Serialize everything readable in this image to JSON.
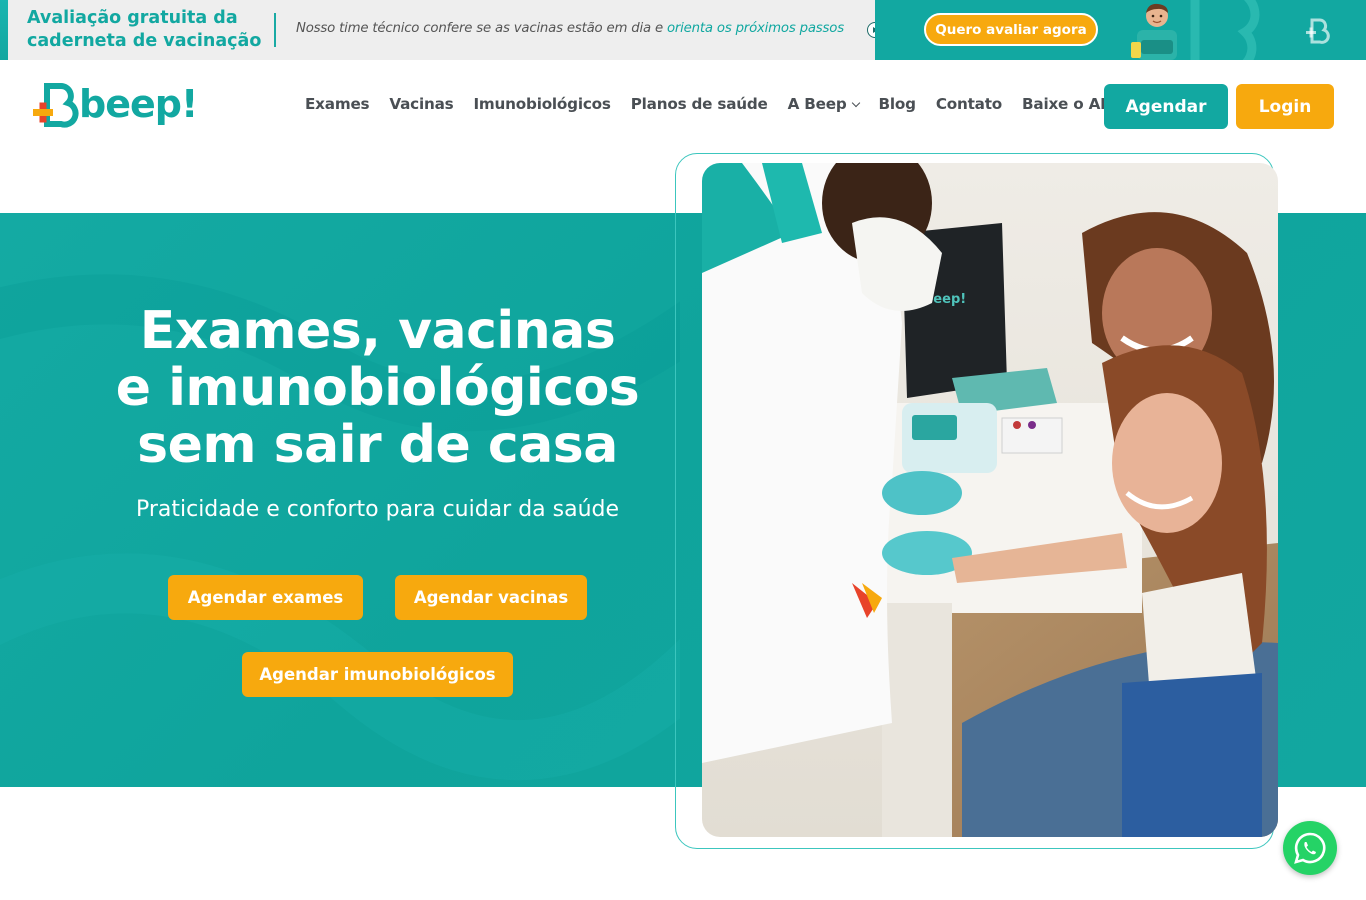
{
  "promo": {
    "title": "Avaliação gratuita da caderneta de vacinação",
    "text_before": "Nosso time técnico confere se as vacinas estão em dia e ",
    "text_link": "orienta os próximos passos",
    "cta_label": "Quero avaliar agora"
  },
  "header": {
    "logo_text": "beep!",
    "nav": [
      {
        "label": "Exames"
      },
      {
        "label": "Vacinas"
      },
      {
        "label": "Imunobiológicos"
      },
      {
        "label": "Planos de saúde"
      },
      {
        "label": "A Beep",
        "has_dropdown": true
      },
      {
        "label": "Blog"
      },
      {
        "label": "Contato"
      },
      {
        "label": "Baixe o APP"
      }
    ],
    "agendar_label": "Agendar",
    "login_label": "Login"
  },
  "hero": {
    "title_line1": "Exames, vacinas",
    "title_line2": "e imunobiológicos",
    "title_line3": "sem sair de casa",
    "subtitle": "Praticidade e conforto para cuidar da saúde",
    "buttons": {
      "exames": "Agendar exames",
      "vacinas": "Agendar vacinas",
      "imuno": "Agendar imunobiológicos"
    }
  },
  "photo": {
    "bag_logo_text": "beep!"
  },
  "icons": {
    "whatsapp": "whatsapp-icon",
    "promo_arrow": "arrow-right-circle-icon",
    "logo_mark": "beep-logo-mark",
    "dropdown": "chevron-down-icon"
  },
  "colors": {
    "brand_teal": "#12a8a1",
    "brand_orange": "#f7a90e",
    "nav_text": "#4a4f54",
    "whatsapp_green": "#25d366"
  }
}
